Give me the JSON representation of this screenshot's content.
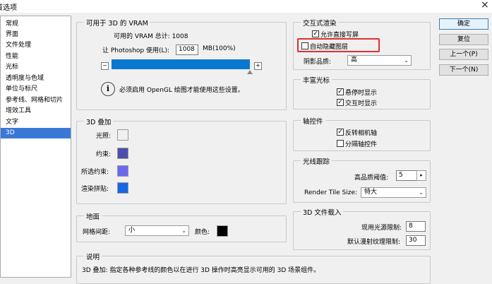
{
  "window": {
    "title": "首选项",
    "close_glyph": "×"
  },
  "sidebar": {
    "items": [
      {
        "label": "常规"
      },
      {
        "label": "界面"
      },
      {
        "label": "文件处理"
      },
      {
        "label": "性能"
      },
      {
        "label": "光标"
      },
      {
        "label": "透明度与色域"
      },
      {
        "label": "单位与标尺"
      },
      {
        "label": "参考线、网格和切片"
      },
      {
        "label": "增效工具"
      },
      {
        "label": "文字"
      },
      {
        "label": "3D"
      }
    ],
    "selected_index": 10
  },
  "vram": {
    "title": "可用于 3D 的 VRAM",
    "available_label": "可用的 VRAM 总计: 1008",
    "let_label": "让 Photoshop 使用(L):",
    "value": "1008",
    "unit": "MB(100%)",
    "slider_fraction": 1.0,
    "minus_glyph": "−",
    "plus_glyph": "+",
    "info_glyph": "i",
    "info_text": "必须启用 OpenGL 绘图才能使用这些设置。"
  },
  "overlay": {
    "title": "3D 叠加",
    "items": [
      {
        "label": "光照:",
        "color": "#f0f0f0"
      },
      {
        "label": "约束:",
        "color": "#4d4dac"
      },
      {
        "label": "所选约束:",
        "color": "#6a6aee"
      },
      {
        "label": "渲染拼贴:",
        "color": "#1766e4"
      }
    ]
  },
  "ground": {
    "title": "地面",
    "grid_label": "网格间距:",
    "grid_value": "小",
    "color_label": "颜色:",
    "color": "#000000"
  },
  "description": {
    "title": "说明",
    "text": "3D 叠加: 指定各种参考线的颜色以在进行 3D 操作时高亮显示可用的 3D 场景组件。"
  },
  "interactive": {
    "title": "交互式渲染",
    "allow_direct_write": {
      "label": "允许直接写屏",
      "checked": true
    },
    "auto_hide_layers": {
      "label": "自动隐藏图层",
      "checked": false
    },
    "shadow_label": "阴影品质:",
    "shadow_value": "高",
    "highlight_color": "#e03030"
  },
  "rich_cursor": {
    "title": "丰富光标",
    "show_on_hover": {
      "label": "悬停时显示",
      "checked": true
    },
    "show_on_interact": {
      "label": "交互时显示",
      "checked": true
    }
  },
  "axis": {
    "title": "轴控件",
    "invert_camera": {
      "label": "反转相机轴",
      "checked": true
    },
    "separate_axis": {
      "label": "分隔轴控件",
      "checked": false
    }
  },
  "raytrace": {
    "title": "光线跟踪",
    "threshold_label": "高品质阈值:",
    "threshold_value": "5",
    "tile_label": "Render Tile Size:",
    "tile_value": "特大"
  },
  "load3d": {
    "title": "3D 文件载入",
    "light_label": "现用光源限制:",
    "light_value": "8",
    "texture_label": "默认漫射纹理限制:",
    "texture_value": "30"
  },
  "buttons": {
    "ok": "确定",
    "reset": "复位",
    "prev": "上一个(P)",
    "next": "下一个(N)"
  }
}
